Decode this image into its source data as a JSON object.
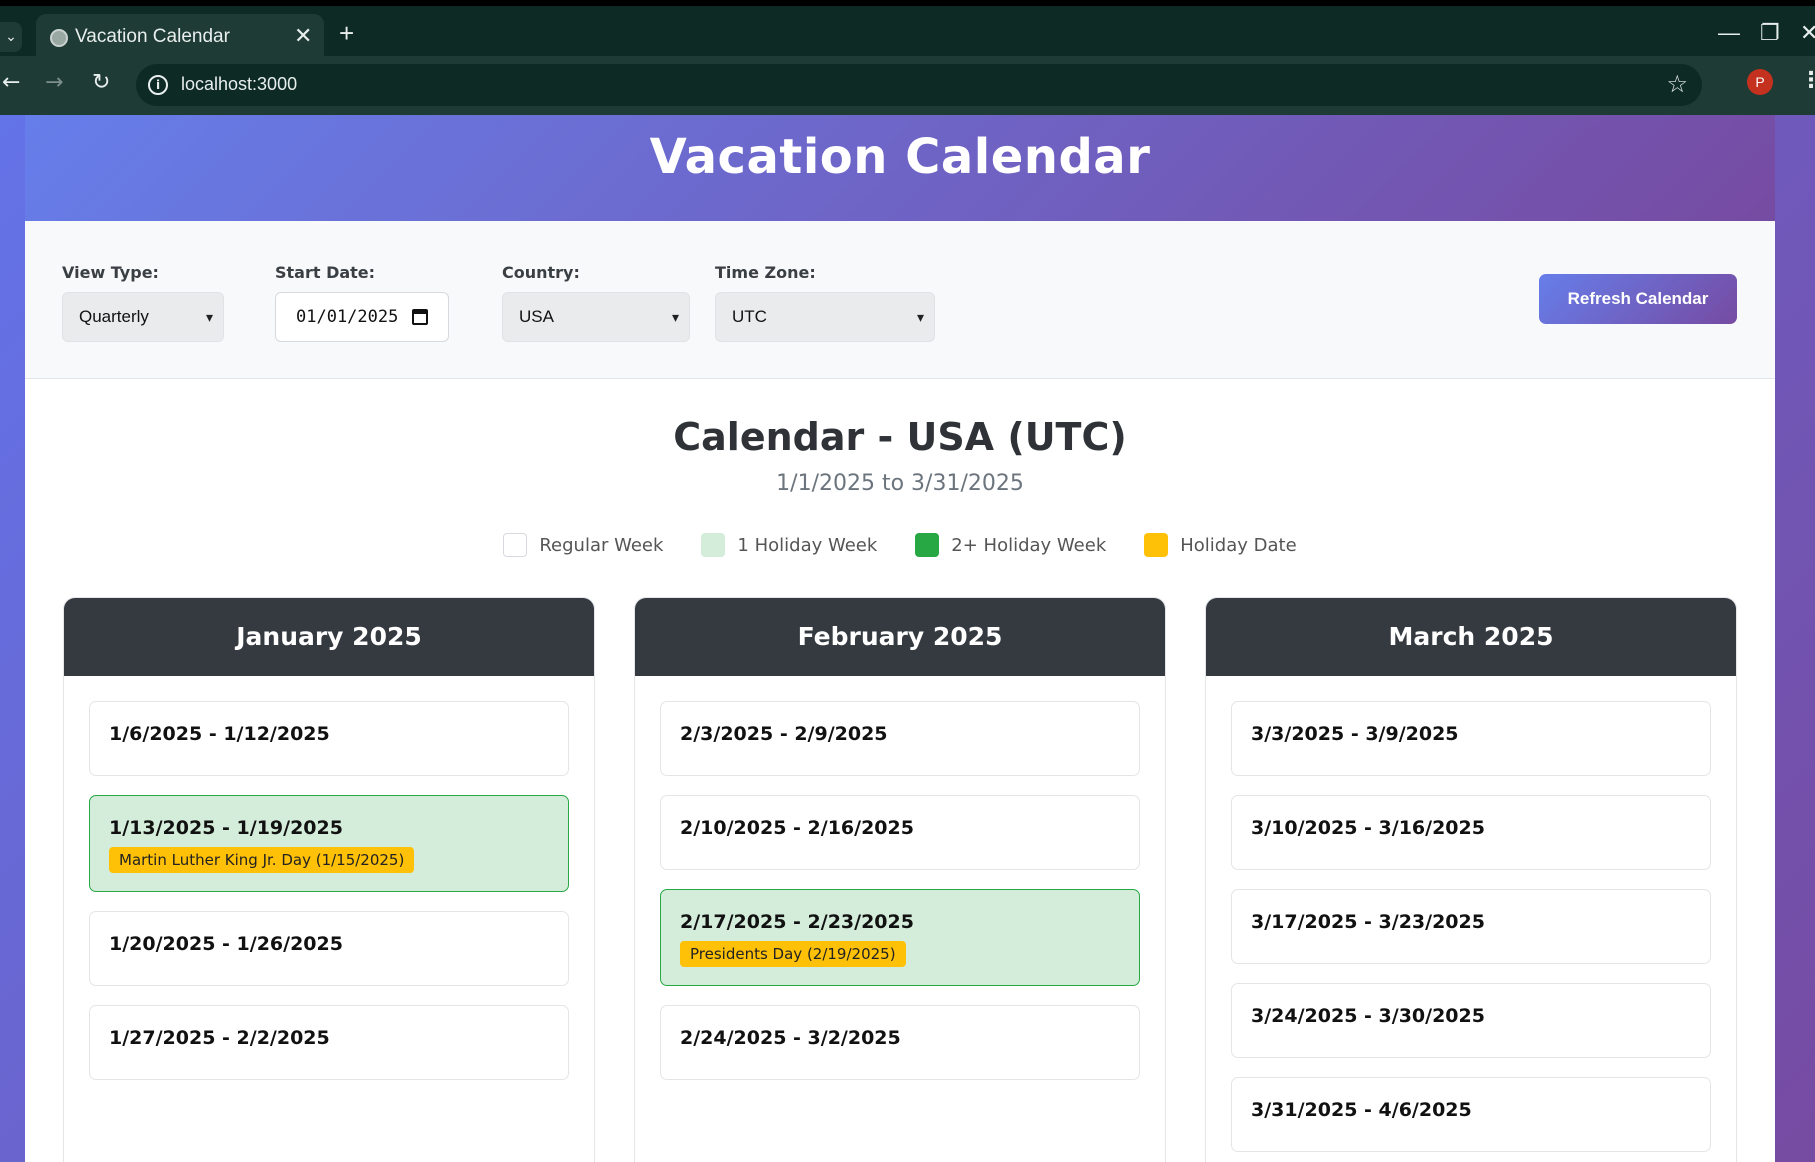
{
  "browser": {
    "tab_title": "Vacation Calendar",
    "url": "localhost:3000",
    "profile_initial": "P"
  },
  "app": {
    "title": "Vacation Calendar"
  },
  "controls": {
    "view_type_label": "View Type:",
    "view_type_value": "Quarterly",
    "start_date_label": "Start Date:",
    "start_date_value": "01/01/2025",
    "country_label": "Country:",
    "country_value": "USA",
    "timezone_label": "Time Zone:",
    "timezone_value": "UTC",
    "refresh_label": "Refresh Calendar"
  },
  "calendar": {
    "title": "Calendar - USA (UTC)",
    "range": "1/1/2025 to 3/31/2025"
  },
  "legend": [
    {
      "label": "Regular Week",
      "color": "#ffffff"
    },
    {
      "label": "1 Holiday Week",
      "color": "#d4edda"
    },
    {
      "label": "2+ Holiday Week",
      "color": "#28a745"
    },
    {
      "label": "Holiday Date",
      "color": "#ffc107"
    }
  ],
  "months": [
    {
      "name": "January 2025",
      "weeks": [
        {
          "range": "1/6/2025 - 1/12/2025",
          "holiday": ""
        },
        {
          "range": "1/13/2025 - 1/19/2025",
          "holiday": "Martin Luther King Jr. Day (1/15/2025)"
        },
        {
          "range": "1/20/2025 - 1/26/2025",
          "holiday": ""
        },
        {
          "range": "1/27/2025 - 2/2/2025",
          "holiday": ""
        }
      ]
    },
    {
      "name": "February 2025",
      "weeks": [
        {
          "range": "2/3/2025 - 2/9/2025",
          "holiday": ""
        },
        {
          "range": "2/10/2025 - 2/16/2025",
          "holiday": ""
        },
        {
          "range": "2/17/2025 - 2/23/2025",
          "holiday": "Presidents Day (2/19/2025)"
        },
        {
          "range": "2/24/2025 - 3/2/2025",
          "holiday": ""
        }
      ]
    },
    {
      "name": "March 2025",
      "weeks": [
        {
          "range": "3/3/2025 - 3/9/2025",
          "holiday": ""
        },
        {
          "range": "3/10/2025 - 3/16/2025",
          "holiday": ""
        },
        {
          "range": "3/17/2025 - 3/23/2025",
          "holiday": ""
        },
        {
          "range": "3/24/2025 - 3/30/2025",
          "holiday": ""
        },
        {
          "range": "3/31/2025 - 4/6/2025",
          "holiday": ""
        }
      ]
    }
  ]
}
